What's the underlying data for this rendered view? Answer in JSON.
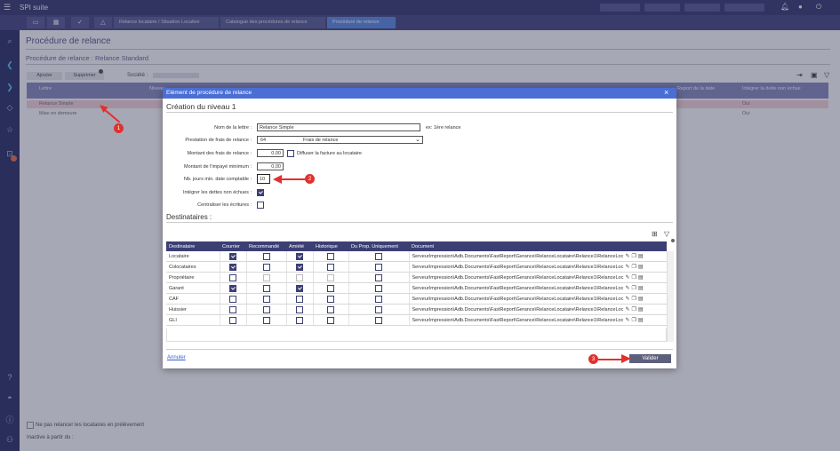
{
  "app": {
    "title": "SPI suite"
  },
  "tabs": [
    {
      "label": "Relance locataire / Situation Locative"
    },
    {
      "label": "Catalogue des procédures de relance"
    },
    {
      "label": "Procédure de relance"
    }
  ],
  "page": {
    "title": "Procédure de relance",
    "subtitle": "Procédure de relance : Relance Standard",
    "buttons": {
      "add": "Ajouter",
      "delete": "Supprimer"
    },
    "societe_label": "Société :",
    "grid_headers": {
      "lettre": "Lettre",
      "niveau": "Niveau",
      "report": "Report de la date",
      "integrer": "Intégrer la dette non échue"
    },
    "grid_rows": [
      {
        "lettre": "Relance Simple",
        "integrer": "Oui"
      },
      {
        "lettre": "Mise en demeure",
        "integrer": "Oui"
      }
    ],
    "option_text": "Ne pas relancer les locataires en prélèvement",
    "inactive_text": "Inactive à partir du :"
  },
  "modal": {
    "title": "Elément de procédure de relance",
    "section_title": "Création du niveau 1",
    "fields": {
      "nom_label": "Nom de la lettre :",
      "nom_value": "Relance Simple",
      "nom_hint": "ex: 1ère relance",
      "prestation_label": "Prestation de frais de relance :",
      "prestation_code": "64",
      "prestation_name": "Frais de relance",
      "montant_frais_label": "Montant des frais de relance :",
      "montant_frais_value": "0,00",
      "diffuser_label": "Diffuser la facture au locataire",
      "montant_impaye_label": "Montant de l'impayé minimum :",
      "montant_impaye_value": "0,00",
      "nb_jours_label": "Nb. jours min. date comptable :",
      "nb_jours_value": "10",
      "integrer_label": "Intégrer les dettes non échues :",
      "centraliser_label": "Centraliser les écritures :"
    },
    "destinataires_title": "Destinataires :",
    "table": {
      "headers": [
        "Destinataire",
        "Courrier",
        "Recommandé",
        "Amiété",
        "Historique",
        "Du Prop. Uniquement",
        "Document"
      ],
      "rows": [
        {
          "name": "Locataire",
          "doc": "ServeurImpression\\Adb.Documents\\FastReport\\Gerance\\RelanceLocataire\\Relance1\\RelanceLoc",
          "courrier": true,
          "recommande": false,
          "amiete": true,
          "historique": false,
          "prop": false
        },
        {
          "name": "Colocataires",
          "doc": "ServeurImpression\\Adb.Documents\\FastReport\\Gerance\\RelanceLocataire\\Relance1\\RelanceLoc",
          "courrier": true,
          "recommande": false,
          "amiete": true,
          "historique": false,
          "prop": false
        },
        {
          "name": "Propriétaire",
          "doc": "ServeurImpression\\Adb.Documents\\FastReport\\Gerance\\RelanceLocataire\\Relance1\\RelanceLoc",
          "courrier": false,
          "recommande": false,
          "amiete": false,
          "historique": false,
          "prop": false
        },
        {
          "name": "Garant",
          "doc": "ServeurImpression\\Adb.Documents\\FastReport\\Gerance\\RelanceLocataire\\Relance1\\RelanceLoc",
          "courrier": true,
          "recommande": false,
          "amiete": true,
          "historique": false,
          "prop": false
        },
        {
          "name": "CAF",
          "doc": "ServeurImpression\\Adb.Documents\\FastReport\\Gerance\\RelanceLocataire\\Relance1\\RelanceLoc",
          "courrier": false,
          "recommande": false,
          "amiete": false,
          "historique": false,
          "prop": false
        },
        {
          "name": "Huissier",
          "doc": "ServeurImpression\\Adb.Documents\\FastReport\\Gerance\\RelanceLocataire\\Relance1\\RelanceLoc",
          "courrier": false,
          "recommande": false,
          "amiete": false,
          "historique": false,
          "prop": false
        },
        {
          "name": "GLI",
          "doc": "ServeurImpression\\Adb.Documents\\FastReport\\Gerance\\RelanceLocataire\\Relance1\\RelanceLoc",
          "courrier": false,
          "recommande": false,
          "amiete": false,
          "historique": false,
          "prop": false
        }
      ]
    },
    "cancel_label": "Annuler",
    "validate_label": "Valider"
  },
  "annotations": {
    "m1": "1",
    "m2": "2",
    "m3": "3"
  },
  "colors": {
    "header": "#3b3f74",
    "modal_header": "#4a6ed3",
    "accent": "#e0312e"
  }
}
